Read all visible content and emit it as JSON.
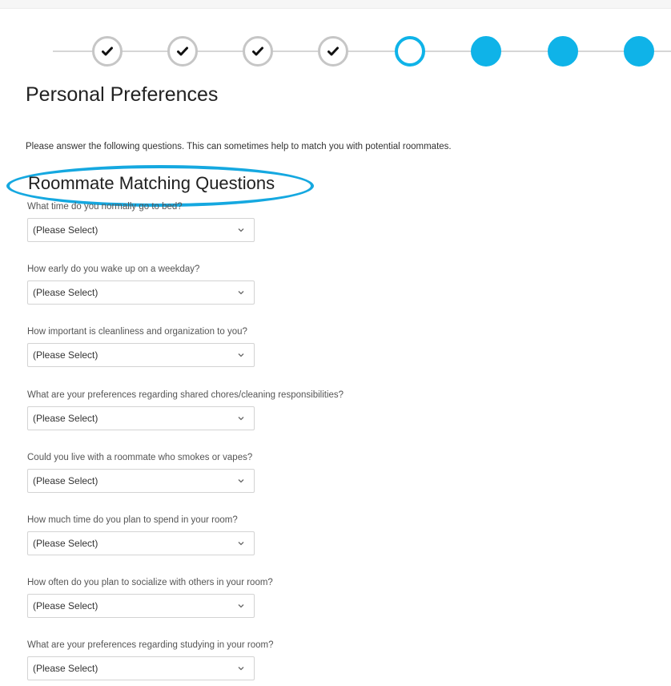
{
  "stepper": {
    "steps": [
      {
        "status": "done"
      },
      {
        "status": "done"
      },
      {
        "status": "done"
      },
      {
        "status": "done"
      },
      {
        "status": "current"
      },
      {
        "status": "future"
      },
      {
        "status": "future"
      },
      {
        "status": "future"
      }
    ],
    "accent_color": "#0fb3e8"
  },
  "page": {
    "title": "Personal Preferences",
    "intro": "Please answer the following questions. This can sometimes help to match you with potential roommates."
  },
  "section": {
    "title": "Roommate Matching Questions",
    "highlight_color": "#15a8e0"
  },
  "questions": [
    {
      "label": "What time do you normally go to bed?",
      "value": "(Please Select)"
    },
    {
      "label": "How early do you wake up on a weekday?",
      "value": "(Please Select)"
    },
    {
      "label": "How important is cleanliness and organization to you?",
      "value": "(Please Select)"
    },
    {
      "label": "What are your preferences regarding shared chores/cleaning responsibilities?",
      "value": "(Please Select)"
    },
    {
      "label": "Could you live with a roommate who smokes or vapes?",
      "value": "(Please Select)"
    },
    {
      "label": "How much time do you plan to spend in your room?",
      "value": "(Please Select)"
    },
    {
      "label": "How often do you plan to socialize with others in your room?",
      "value": "(Please Select)"
    },
    {
      "label": "What are your preferences regarding studying in your room?",
      "value": "(Please Select)"
    }
  ]
}
